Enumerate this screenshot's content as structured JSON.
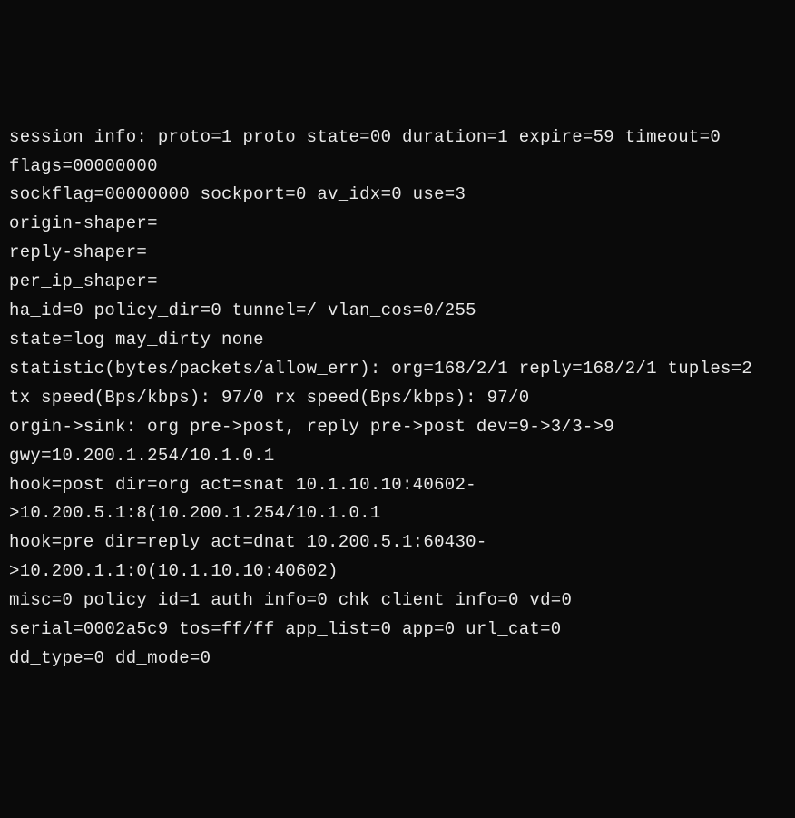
{
  "terminal": {
    "lines": [
      "session info: proto=1 proto_state=00 duration=1 expire=59 timeout=0 flags=00000000",
      "sockflag=00000000 sockport=0 av_idx=0 use=3",
      "origin-shaper=",
      "reply-shaper=",
      "per_ip_shaper=",
      "ha_id=0 policy_dir=0 tunnel=/ vlan_cos=0/255",
      "state=log may_dirty none",
      "statistic(bytes/packets/allow_err): org=168/2/1 reply=168/2/1 tuples=2",
      "tx speed(Bps/kbps): 97/0 rx speed(Bps/kbps): 97/0",
      "orgin->sink: org pre->post, reply pre->post dev=9->3/3->9 gwy=10.200.1.254/10.1.0.1",
      "hook=post dir=org act=snat 10.1.10.10:40602->10.200.5.1:8(10.200.1.254/10.1.0.1",
      "hook=pre dir=reply act=dnat 10.200.5.1:60430->10.200.1.1:0(10.1.10.10:40602)",
      "misc=0 policy_id=1 auth_info=0 chk_client_info=0 vd=0",
      "serial=0002a5c9 tos=ff/ff app_list=0 app=0 url_cat=0",
      "dd_type=0 dd_mode=0"
    ]
  }
}
